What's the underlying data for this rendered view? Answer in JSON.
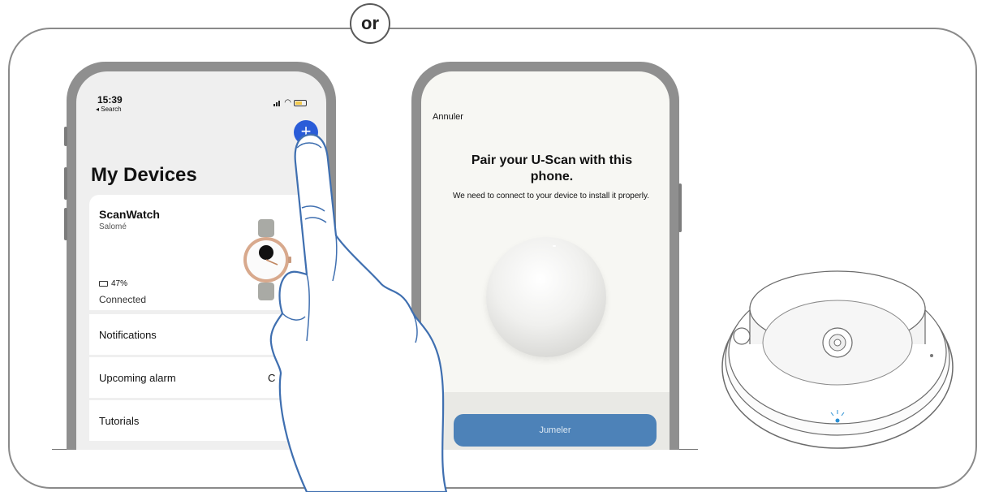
{
  "divider": {
    "label": "or"
  },
  "phone_devices": {
    "status": {
      "time": "15:39",
      "back_label": "◂ Search"
    },
    "add_button": "+",
    "title": "My Devices",
    "device": {
      "name": "ScanWatch",
      "owner": "Salomé",
      "battery": "47%",
      "connection": "Connected"
    },
    "menu": [
      {
        "label": "Notifications",
        "value": ""
      },
      {
        "label": "Upcoming alarm",
        "value": "C"
      },
      {
        "label": "Tutorials",
        "value": ""
      }
    ]
  },
  "phone_pair": {
    "cancel_label": "Annuler",
    "title": "Pair your U-Scan with this phone.",
    "subtitle": "We need to connect to your device to install it properly.",
    "pair_button": "Jumeler",
    "accent_color": "#4d82b8"
  },
  "icons": [
    "signal-icon",
    "wifi-icon",
    "battery-icon",
    "plus-icon",
    "pointing-hand-icon",
    "u-scan-device-icon"
  ]
}
